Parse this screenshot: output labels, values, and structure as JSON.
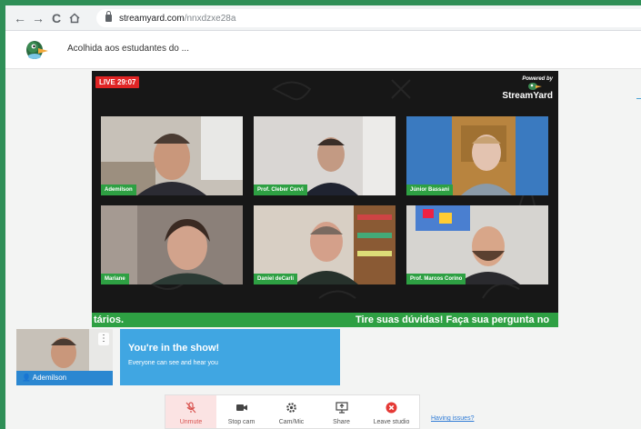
{
  "browser": {
    "url_host": "streamyard.com",
    "url_path": "/nnxdzxe28a"
  },
  "header": {
    "broadcast_title": "Acolhida aos estudantes do ..."
  },
  "stage": {
    "live_badge": "LIVE 29:07",
    "powered_by": "Powered by",
    "brand": "StreamYard",
    "participants": [
      {
        "name": "Ademilson"
      },
      {
        "name": "Prof. Cleber Cervi"
      },
      {
        "name": "Júnior Bassani"
      },
      {
        "name": "Mariane"
      },
      {
        "name": "Daniel deCarli"
      },
      {
        "name": "Prof. Marcos Corino"
      }
    ],
    "ticker_left": "tários.",
    "ticker_right": "Tire suas dúvidas! Faça sua pergunta no"
  },
  "self_preview": {
    "name": "Ademilson",
    "menu_glyph": "⋮"
  },
  "status": {
    "title": "You're in the show!",
    "subtitle": "Everyone can see and hear you"
  },
  "controls": {
    "unmute": "Unmute",
    "stop_cam": "Stop cam",
    "cam_mic": "Cam/Mic",
    "share": "Share",
    "leave": "Leave studio"
  },
  "help_link": "Having issues?",
  "colors": {
    "accent_green": "#2ea043",
    "live_red": "#e02424",
    "status_blue": "#40a6e2",
    "name_blue": "#2b87d1"
  }
}
